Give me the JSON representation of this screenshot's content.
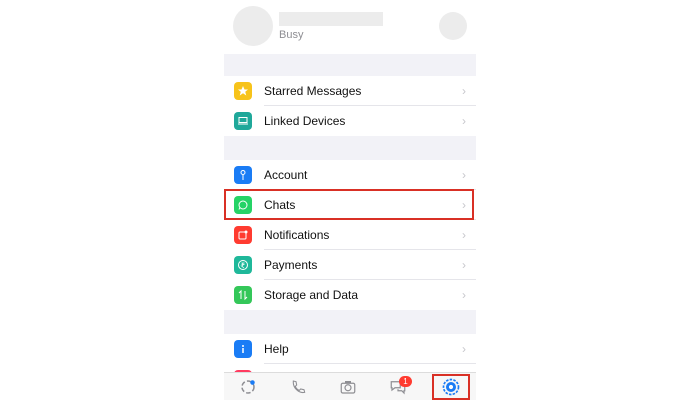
{
  "profile": {
    "status": "Busy"
  },
  "menu": {
    "starred": "Starred Messages",
    "linked": "Linked Devices",
    "account": "Account",
    "chats": "Chats",
    "notifications": "Notifications",
    "payments": "Payments",
    "storage": "Storage and Data",
    "help": "Help"
  },
  "chevron": "›",
  "tabs": {
    "chats_badge": "1"
  },
  "colors": {
    "starred": "#f7c31a",
    "linked": "#1fa89a",
    "account": "#1a7cf5",
    "chats": "#25d366",
    "notifications": "#ff3b30",
    "payments": "#1fb89a",
    "storage": "#34c759",
    "help": "#1a7cf5",
    "highlight": "#d93025"
  },
  "icons": {
    "starred": "star-icon",
    "linked": "laptop-icon",
    "account": "key-icon",
    "chats": "whatsapp-icon",
    "notifications": "notification-icon",
    "payments": "rupee-icon",
    "storage": "arrows-icon",
    "help": "info-icon"
  }
}
